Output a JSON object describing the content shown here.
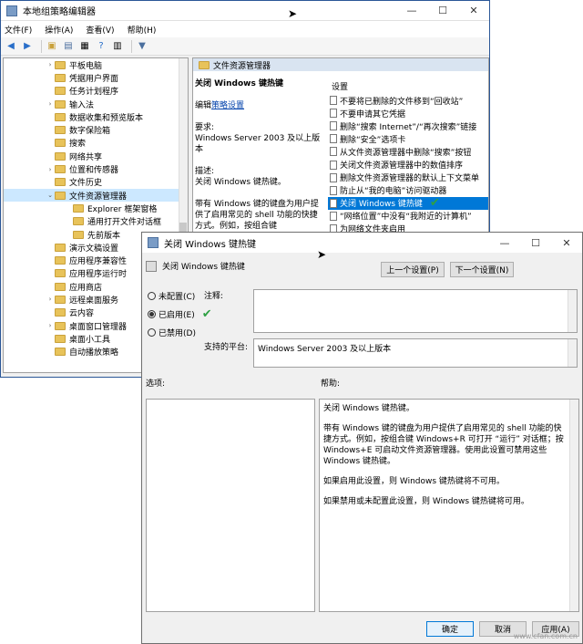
{
  "main_window": {
    "title": "本地组策略编辑器",
    "menu": [
      "文件(F)",
      "操作(A)",
      "查看(V)",
      "帮助(H)"
    ],
    "tree_items": [
      {
        "label": "平板电脑",
        "indent": 1,
        "expander": "›"
      },
      {
        "label": "凭据用户界面",
        "indent": 1,
        "expander": ""
      },
      {
        "label": "任务计划程序",
        "indent": 1,
        "expander": ""
      },
      {
        "label": "输入法",
        "indent": 1,
        "expander": "›"
      },
      {
        "label": "数据收集和预览版本",
        "indent": 1,
        "expander": ""
      },
      {
        "label": "数字保险箱",
        "indent": 1,
        "expander": ""
      },
      {
        "label": "搜索",
        "indent": 1,
        "expander": ""
      },
      {
        "label": "网络共享",
        "indent": 1,
        "expander": ""
      },
      {
        "label": "位置和传感器",
        "indent": 1,
        "expander": "›"
      },
      {
        "label": "文件历史",
        "indent": 1,
        "expander": ""
      },
      {
        "label": "文件资源管理器",
        "indent": 1,
        "expander": "⌄",
        "selected": true
      },
      {
        "label": "Explorer 框架窗格",
        "indent": 2,
        "expander": ""
      },
      {
        "label": "通用打开文件对话框",
        "indent": 2,
        "expander": ""
      },
      {
        "label": "先前版本",
        "indent": 2,
        "expander": ""
      },
      {
        "label": "演示文稿设置",
        "indent": 1,
        "expander": ""
      },
      {
        "label": "应用程序兼容性",
        "indent": 1,
        "expander": ""
      },
      {
        "label": "应用程序运行时",
        "indent": 1,
        "expander": ""
      },
      {
        "label": "应用商店",
        "indent": 1,
        "expander": ""
      },
      {
        "label": "远程桌面服务",
        "indent": 1,
        "expander": "›"
      },
      {
        "label": "云内容",
        "indent": 1,
        "expander": ""
      },
      {
        "label": "桌面窗口管理器",
        "indent": 1,
        "expander": "›"
      },
      {
        "label": "桌面小工具",
        "indent": 1,
        "expander": ""
      },
      {
        "label": "自动播放策略",
        "indent": 1,
        "expander": ""
      }
    ],
    "content_header": "文件资源管理器",
    "desc_title": "关闭 Windows 键热键",
    "desc_edit_prefix": "编辑",
    "desc_edit_link": "策略设置",
    "desc_req_label": "要求:",
    "desc_req_value": "Windows Server 2003 及以上版本",
    "desc_desc_label": "描述:",
    "desc_desc_value": "关闭 Windows 键热键。",
    "desc_body": "带有 Windows 键的键盘为用户提供了启用常见的 shell 功能的快捷方式。例如，按组合键 Windows+R 可打开“运行”对话框；按 Windows+E 可启",
    "settings_header": "设置",
    "settings_items": [
      "不要将已删除的文件移到“回收站”",
      "不要申请其它凭据",
      "删除“搜索 Internet”/“再次搜索”链接",
      "删除“安全”选项卡",
      "从文件资源管理器中删除“搜索”按钮",
      "关闭文件资源管理器中的数值排序",
      "删除文件资源管理器的默认上下文菜单",
      "防止从“我的电脑”访问驱动器",
      "关闭 Windows 键热键",
      "“网络位置”中没有“我附近的计算机”",
      "为网络文件夹启用"
    ],
    "settings_selected_index": 8
  },
  "dialog": {
    "title": "关闭 Windows 键热键",
    "setting_name": "关闭 Windows 键热键",
    "prev_button": "上一个设置(P)",
    "next_button": "下一个设置(N)",
    "radio_not_configured": "未配置(C)",
    "radio_enabled": "已启用(E)",
    "radio_disabled": "已禁用(D)",
    "selected_radio": "enabled",
    "comment_label": "注释:",
    "platform_label": "支持的平台:",
    "platform_value": "Windows Server 2003 及以上版本",
    "options_label": "选项:",
    "help_label": "帮助:",
    "help_paragraphs": [
      "关闭 Windows 键热键。",
      "带有 Windows 键的键盘为用户提供了启用常见的 shell 功能的快捷方式。例如，按组合键 Windows+R 可打开 “运行” 对话框；按 Windows+E 可启动文件资源管理器。使用此设置可禁用这些 Windows 键热键。",
      "如果启用此设置，则 Windows 键热键将不可用。",
      "如果禁用或未配置此设置，则 Windows 键热键将可用。"
    ],
    "ok_button": "确定",
    "cancel_button": "取消",
    "apply_button": "应用(A)"
  },
  "watermark": "www.cfan.com.cn",
  "colors": {
    "accent": "#0078d7",
    "check": "#2ea043",
    "folder": "#e8c35a"
  }
}
